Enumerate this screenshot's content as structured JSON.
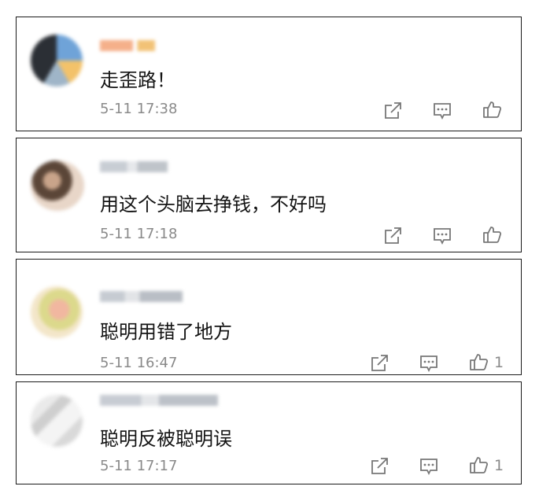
{
  "comments": [
    {
      "text": "走歪路！",
      "time": "5-11 17:38",
      "likes": ""
    },
    {
      "text": "用这个头脑去挣钱，不好吗",
      "time": "5-11 17:18",
      "likes": ""
    },
    {
      "text": "聪明用错了地方",
      "time": "5-11 16:47",
      "likes": "1"
    },
    {
      "text": "聪明反被聪明误",
      "time": "5-11 17:17",
      "likes": "1"
    }
  ],
  "icons": {
    "share": "share-icon",
    "reply": "comment-icon",
    "like": "thumbs-up-icon"
  }
}
